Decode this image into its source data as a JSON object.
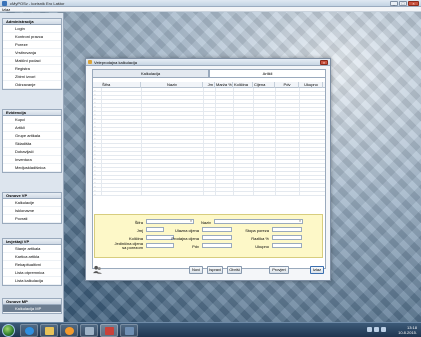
{
  "app": {
    "title": "cMyPOSv - korisnik Ero Laštor",
    "menu": [
      "Izlaz"
    ]
  },
  "sidebar": {
    "sections": [
      {
        "title": "Administracija",
        "items": [
          "Login",
          "Kontroni pravca",
          "Poreze",
          "Vrstirovanja",
          "Matični podaci",
          "Registra",
          "Zbirni izvori",
          "Odrzavanje"
        ]
      },
      {
        "title": "Evidencija",
        "items": [
          "Kupci",
          "Artikli",
          "Grupe artikala",
          "Skladišta",
          "Dobavljači",
          "Inventura",
          "Medjuskladišnica"
        ]
      },
      {
        "title": "Osnove VP",
        "items": [
          "Kalkulacije",
          "Isklonavne",
          "Povrati"
        ]
      },
      {
        "title": "Izvještaji VP",
        "items": [
          "Stanje artikala",
          "Kartica artikla",
          "Rekapitualtivni",
          "Lista otpremnica",
          "Lista kalkulacija"
        ]
      },
      {
        "title": "Osnove MP",
        "items": [
          "Kalkulacija MP"
        ]
      }
    ]
  },
  "dialog": {
    "title": "Veleprodajna kalkulacija",
    "tabs": [
      "Kalkulacija",
      "Artikli"
    ],
    "active_tab": "Artikli",
    "columns": [
      "Šifra",
      "Naziv",
      "Jm",
      "Marža %",
      "Količina",
      "Cijena",
      "Pdv",
      "Ukupno"
    ],
    "form": {
      "sifra_label": "Šifra",
      "naziv_label": "Naziv",
      "jmj_label": "Jmj",
      "ulazna_cijena_label": "Ulazna cijena",
      "stopa_poreza_label": "Stopa poreza",
      "kolicina_label": "Količina",
      "prodajna_cijena_label": "Prodajna cijena",
      "razlika_label": "Razlika %",
      "jedinicna_label_1": "Jedinična cijena",
      "jedinicna_label_2": "sa porezom",
      "pdv_label": "Pdv",
      "ukupno_label": "Ukupno"
    },
    "buttons": {
      "novi": "Novi",
      "ispravi": "Ispravi",
      "obrisi": "Obriši",
      "provjeri": "Provjeri",
      "izlaz": "Izlaz"
    }
  },
  "taskbar": {
    "time": "13:18",
    "date": "10.8.2015."
  },
  "colors": {
    "form_bg": "#fdf8c8",
    "active_sidebar": "#6d7e91",
    "close_red": "#c9523f"
  }
}
